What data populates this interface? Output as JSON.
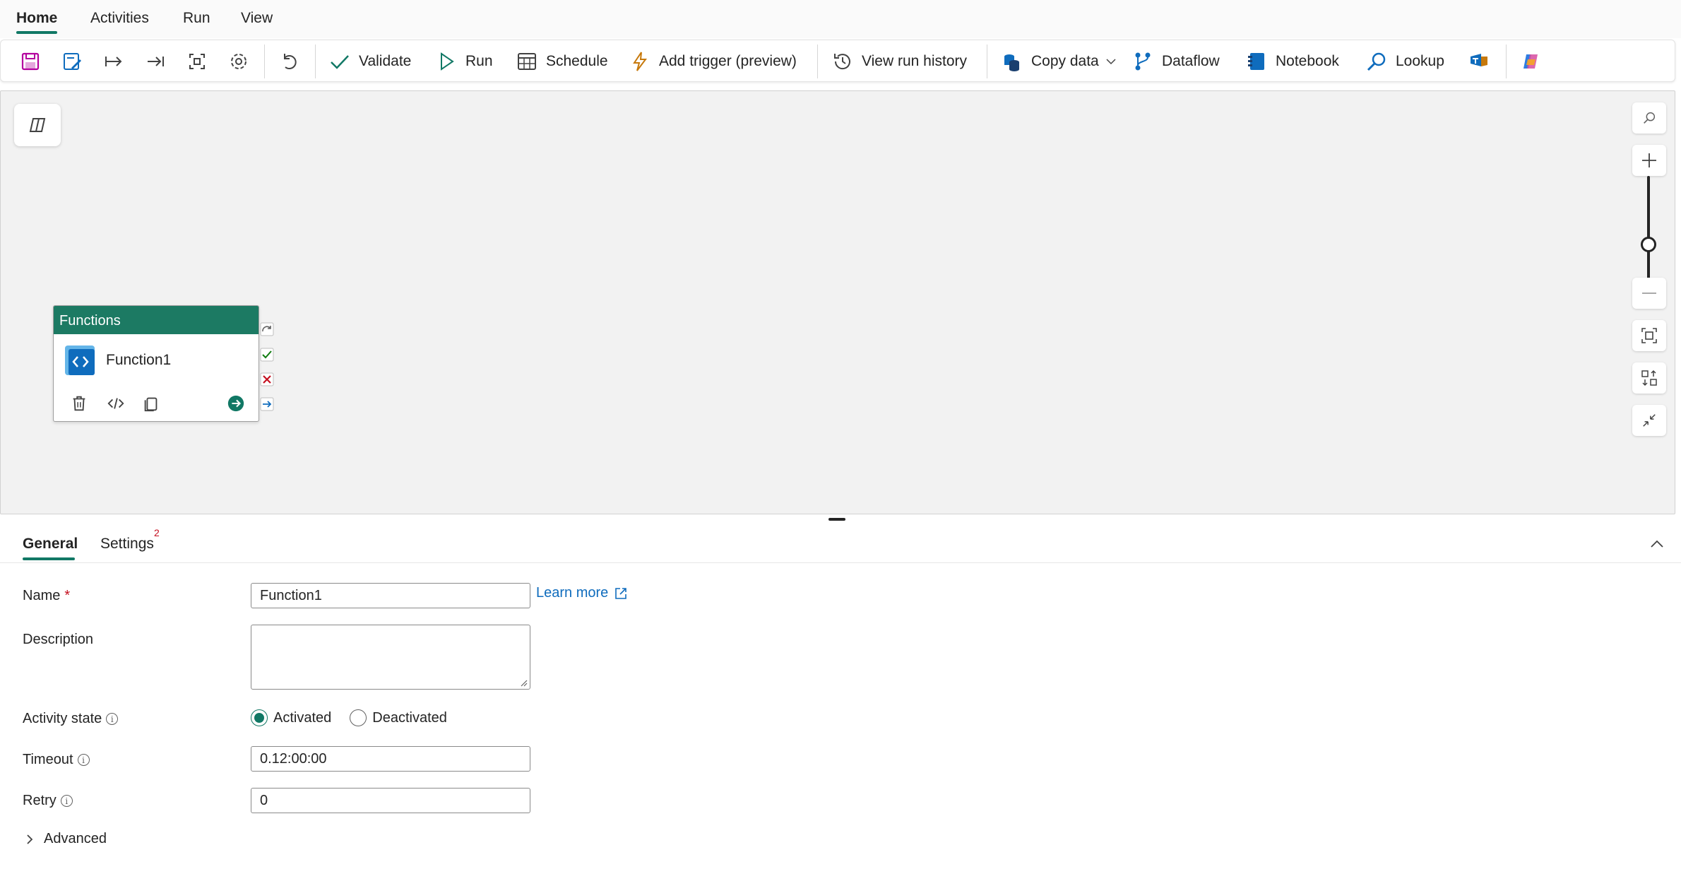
{
  "menu": {
    "tabs": [
      {
        "label": "Home",
        "active": true
      },
      {
        "label": "Activities",
        "active": false
      },
      {
        "label": "Run",
        "active": false
      },
      {
        "label": "View",
        "active": false
      }
    ]
  },
  "toolbar": {
    "icons": [
      "save-icon",
      "save-as-icon",
      "move-right-icon",
      "move-end-icon",
      "fit-view-icon",
      "gear-icon",
      "undo-icon"
    ],
    "validate": "Validate",
    "run": "Run",
    "schedule": "Schedule",
    "add_trigger": "Add trigger (preview)",
    "view_run_history": "View run history",
    "copy_data": "Copy data",
    "dataflow": "Dataflow",
    "notebook": "Notebook",
    "lookup": "Lookup",
    "extra_icons": [
      "teams-icon",
      "copilot-icon"
    ]
  },
  "canvas": {
    "node": {
      "header": "Functions",
      "name": "Function1",
      "ports": [
        "skip",
        "success",
        "fail",
        "complete"
      ]
    },
    "zoom_level": 0.55
  },
  "panel": {
    "tabs": [
      {
        "label": "General",
        "active": true
      },
      {
        "label": "Settings",
        "active": false,
        "badge": "2"
      }
    ],
    "fields": {
      "name_label": "Name",
      "name_required": "*",
      "name_value": "Function1",
      "learn_more": "Learn more",
      "description_label": "Description",
      "description_value": "",
      "activity_state_label": "Activity state",
      "activated": "Activated",
      "deactivated": "Deactivated",
      "activity_state_value": "Activated",
      "timeout_label": "Timeout",
      "timeout_value": "0.12:00:00",
      "retry_label": "Retry",
      "retry_value": "0",
      "advanced_label": "Advanced"
    }
  },
  "colors": {
    "accent": "#117865",
    "node_header": "#1c7a63",
    "link": "#0f6cbd",
    "required": "#c50f1f"
  }
}
